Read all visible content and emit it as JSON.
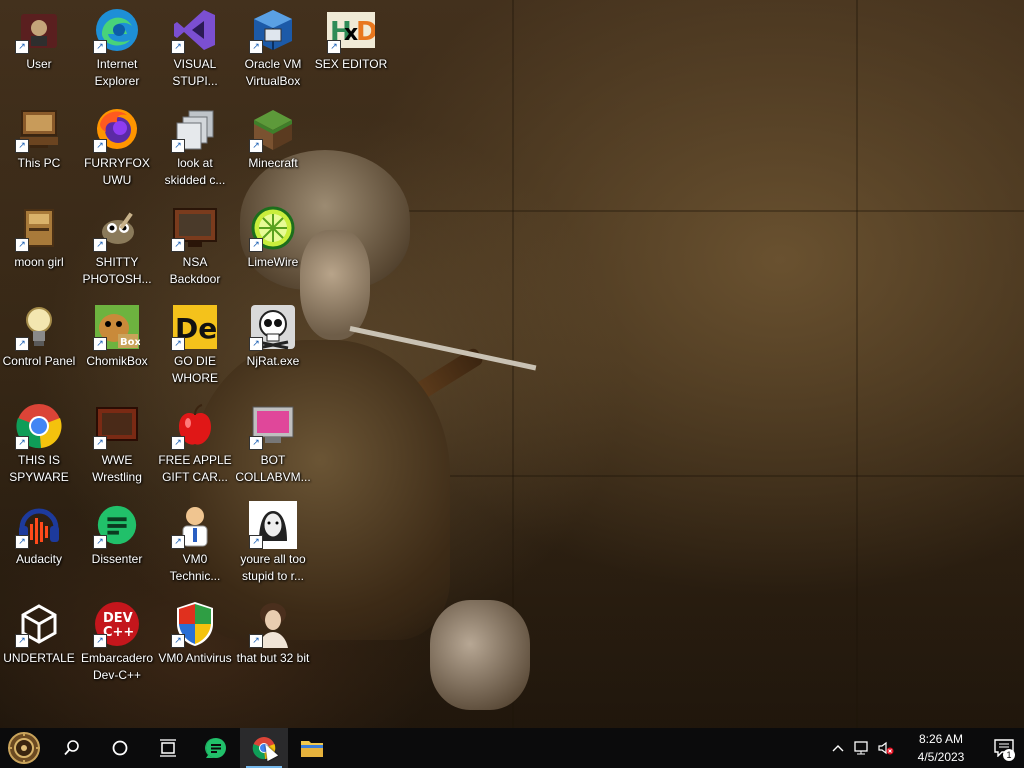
{
  "desktop_icons": [
    {
      "id": "user",
      "label": "User",
      "col": 0,
      "row": 0,
      "icon": "user-folder-icon"
    },
    {
      "id": "internet-explorer",
      "label": "Internet Explorer",
      "col": 1,
      "row": 0,
      "icon": "edge-icon"
    },
    {
      "id": "visual-studio",
      "label": "VISUAL STUPI...",
      "col": 2,
      "row": 0,
      "icon": "visual-studio-icon"
    },
    {
      "id": "virtualbox",
      "label": "Oracle VM VirtualBox",
      "col": 3,
      "row": 0,
      "icon": "virtualbox-icon"
    },
    {
      "id": "hxd",
      "label": "SEX EDITOR",
      "col": 4,
      "row": 0,
      "icon": "hxd-icon"
    },
    {
      "id": "this-pc",
      "label": "This PC",
      "col": 0,
      "row": 1,
      "icon": "computer-icon"
    },
    {
      "id": "firefox",
      "label": "FURRYFOX UWU",
      "col": 1,
      "row": 1,
      "icon": "firefox-icon"
    },
    {
      "id": "look-at",
      "label": "look at skidded c...",
      "col": 2,
      "row": 1,
      "icon": "copy-windows-icon"
    },
    {
      "id": "minecraft",
      "label": "Minecraft",
      "col": 3,
      "row": 1,
      "icon": "minecraft-icon"
    },
    {
      "id": "moon-girl",
      "label": "moon girl",
      "col": 0,
      "row": 2,
      "icon": "book-folder-icon"
    },
    {
      "id": "gimp",
      "label": "SHITTY PHOTOSH...",
      "col": 1,
      "row": 2,
      "icon": "gimp-icon"
    },
    {
      "id": "nsa-backdoor",
      "label": "NSA Backdoor",
      "col": 2,
      "row": 2,
      "icon": "monitor-icon"
    },
    {
      "id": "limewire",
      "label": "LimeWire",
      "col": 3,
      "row": 2,
      "icon": "limewire-icon"
    },
    {
      "id": "control-panel",
      "label": "Control Panel",
      "col": 0,
      "row": 3,
      "icon": "lightbulb-icon"
    },
    {
      "id": "chomikbox",
      "label": "ChomikBox",
      "col": 1,
      "row": 3,
      "icon": "chomikbox-icon"
    },
    {
      "id": "go-die",
      "label": "GO DIE WHORE",
      "col": 2,
      "row": 3,
      "icon": "de-icon"
    },
    {
      "id": "njrat",
      "label": "NjRat.exe",
      "col": 3,
      "row": 3,
      "icon": "skull-icon"
    },
    {
      "id": "chrome-spyware",
      "label": "THIS IS SPYWARE",
      "col": 0,
      "row": 4,
      "icon": "chrome-icon"
    },
    {
      "id": "wwe",
      "label": "WWE Wrestling",
      "col": 1,
      "row": 4,
      "icon": "tv-icon"
    },
    {
      "id": "apple-gift",
      "label": "FREE APPLE GIFT CAR...",
      "col": 2,
      "row": 4,
      "icon": "apple-icon"
    },
    {
      "id": "bot-collabvm",
      "label": "BOT COLLABVM...",
      "col": 3,
      "row": 4,
      "icon": "pink-monitor-icon"
    },
    {
      "id": "audacity",
      "label": "Audacity",
      "col": 0,
      "row": 5,
      "icon": "audacity-icon"
    },
    {
      "id": "dissenter",
      "label": "Dissenter",
      "col": 1,
      "row": 5,
      "icon": "dissenter-icon"
    },
    {
      "id": "vm0-tech",
      "label": "VM0 Technic...",
      "col": 2,
      "row": 5,
      "icon": "doctor-icon"
    },
    {
      "id": "youre-all",
      "label": "youre all too stupid to r...",
      "col": 3,
      "row": 5,
      "icon": "portrait-sketch-icon"
    },
    {
      "id": "undertale",
      "label": "UNDERTALE",
      "col": 0,
      "row": 6,
      "icon": "unity-icon"
    },
    {
      "id": "devcpp",
      "label": "Embarcadero Dev-C++",
      "col": 1,
      "row": 6,
      "icon": "devcpp-icon"
    },
    {
      "id": "vm0-antivirus",
      "label": "VM0 Antivirus",
      "col": 2,
      "row": 6,
      "icon": "shield-icon"
    },
    {
      "id": "that-but-32",
      "label": "that but 32 bit",
      "col": 3,
      "row": 6,
      "icon": "lady-portrait-icon"
    }
  ],
  "taskbar": {
    "start_icon": "steampunk-start-icon",
    "pinned": [
      {
        "id": "search",
        "icon": "search-icon"
      },
      {
        "id": "cortana",
        "icon": "cortana-circle-icon"
      },
      {
        "id": "task-view",
        "icon": "task-view-icon"
      },
      {
        "id": "dissenter",
        "icon": "dissenter-icon"
      },
      {
        "id": "chrome",
        "icon": "chrome-icon",
        "active": true
      },
      {
        "id": "explorer",
        "icon": "folder-icon"
      }
    ],
    "clock": {
      "time": "8:26 AM",
      "date": "4/5/2023"
    },
    "notification_count": "1"
  },
  "colors": {
    "taskbar": "#0b0b0c",
    "accent": "#76b9ed",
    "label": "#ffffff"
  }
}
